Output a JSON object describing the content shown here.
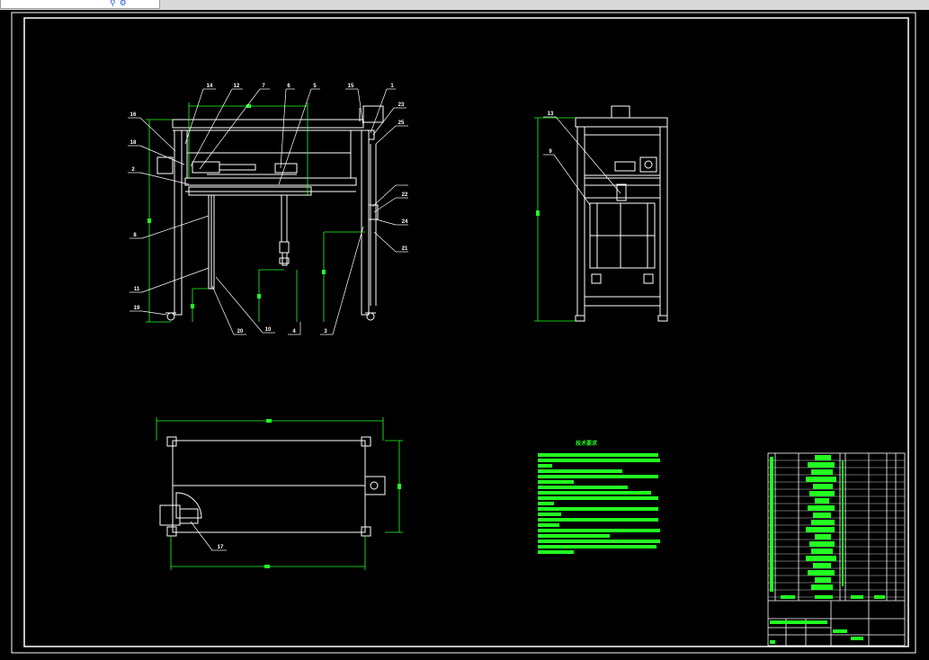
{
  "drawing": {
    "front_view_labels": [
      "14",
      "12",
      "7",
      "6",
      "5",
      "15",
      "1",
      "23",
      "16",
      "18",
      "2",
      "8",
      "11",
      "19",
      "20",
      "10",
      "4",
      "3",
      "25",
      "22",
      "24",
      "21"
    ],
    "side_view_labels": [
      "13",
      "9"
    ],
    "top_view_labels": [
      "17"
    ],
    "notes_heading": "技术要求"
  },
  "colors": {
    "background": "#000000",
    "lines": "#ffffff",
    "dimensions": "#22ff22"
  }
}
